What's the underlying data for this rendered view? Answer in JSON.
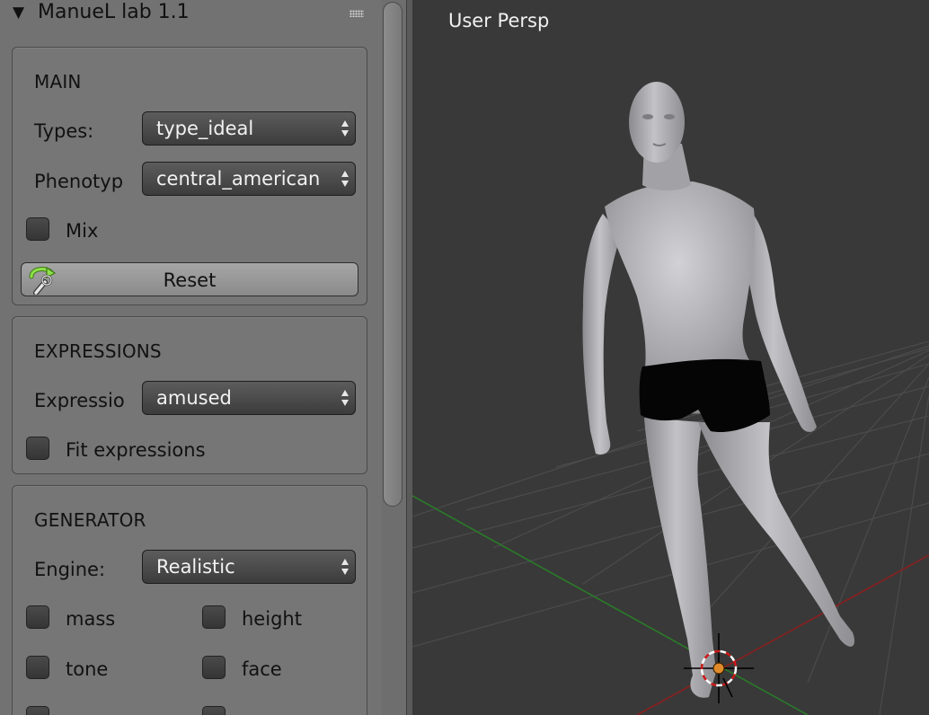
{
  "panel": {
    "title": "ManueL lab 1.1",
    "main": {
      "title": "MAIN",
      "types_label": "Types:",
      "types_value": "type_ideal",
      "phenotype_label": "Phenotyp",
      "phenotype_value": "central_american",
      "mix_label": "Mix",
      "reset_label": "Reset"
    },
    "expressions": {
      "title": "EXPRESSIONS",
      "expression_label": "Expressio",
      "expression_value": "amused",
      "fit_label": "Fit expressions"
    },
    "generator": {
      "title": "GENERATOR",
      "engine_label": "Engine:",
      "engine_value": "Realistic",
      "checks": [
        "mass",
        "height",
        "tone",
        "face"
      ]
    }
  },
  "viewport": {
    "label": "User Persp"
  },
  "colors": {
    "panel_bg": "#727272",
    "viewport_bg": "#393939",
    "x_axis": "#8a1f1f",
    "y_axis": "#2a7a2a",
    "grid": "#4d4d4d",
    "model_skin": "#a9a9ad",
    "underwear": "#050505"
  }
}
